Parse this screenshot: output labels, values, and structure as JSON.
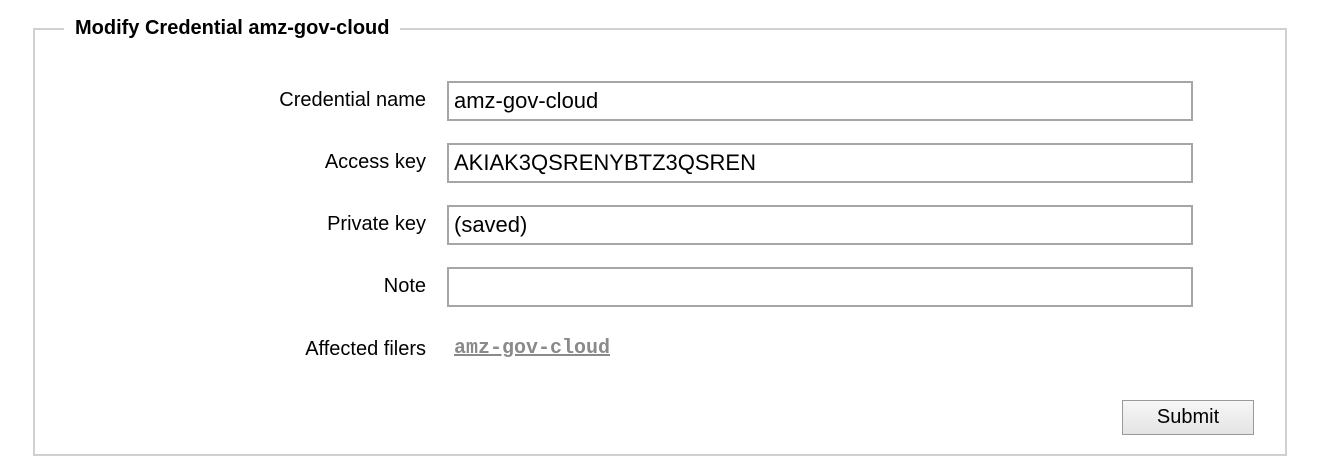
{
  "form": {
    "legend": "Modify Credential amz-gov-cloud",
    "fields": [
      {
        "label": "Credential name",
        "value": "amz-gov-cloud"
      },
      {
        "label": "Access key",
        "value": "AKIAK3QSRENYBTZ3QSREN"
      },
      {
        "label": "Private key",
        "value": "(saved)"
      },
      {
        "label": "Note",
        "value": ""
      }
    ],
    "affected": {
      "label": "Affected filers",
      "link": "amz-gov-cloud"
    },
    "submit_label": "Submit"
  }
}
